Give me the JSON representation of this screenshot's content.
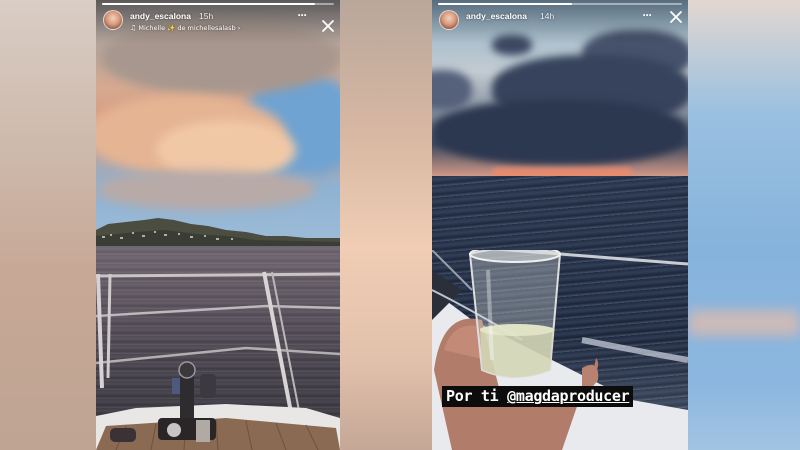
{
  "stories": [
    {
      "username": "andy_escalona",
      "time": "15h",
      "music": {
        "artist": "Michelle",
        "separator": "✨",
        "by_label": "de",
        "source": "michellesalasb",
        "chevron": "›"
      },
      "progress": 0.92,
      "icons": [
        "avatar",
        "more-icon",
        "close-icon",
        "music-icon"
      ]
    },
    {
      "username": "andy_escalona",
      "time": "14h",
      "caption": "Por ti",
      "mention": "@magdaproducer",
      "progress": 0.55,
      "icons": [
        "avatar",
        "more-icon",
        "close-icon"
      ]
    }
  ],
  "colors": {
    "caption_bg": "#0c0c0c",
    "caption_text": "#ffffff",
    "header_text": "#ffffff"
  }
}
